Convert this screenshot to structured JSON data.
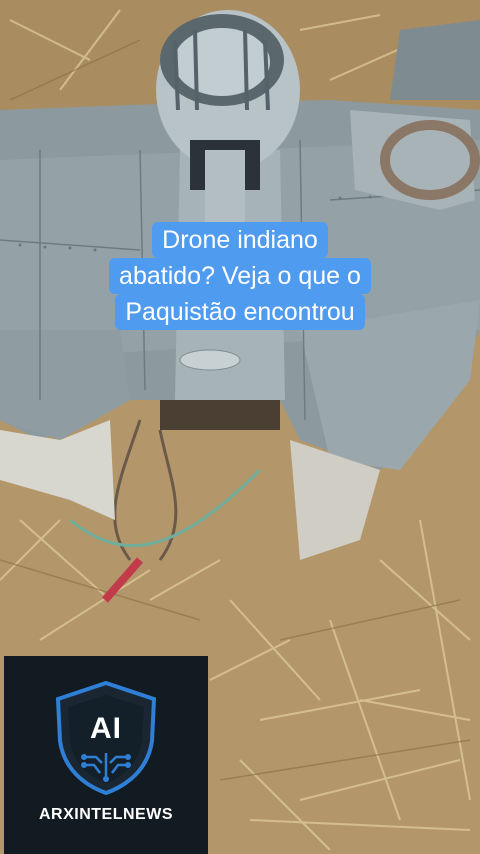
{
  "caption": {
    "line1": "Drone indiano",
    "line2": "abatido? Veja o que o",
    "line3": "Paquistão encontrou"
  },
  "logo": {
    "mark_text": "AI",
    "brand_name": "ARXINTELNEWS",
    "icon": "shield-circuit-icon"
  },
  "colors": {
    "caption_bg": "#4f9bf0",
    "logo_bg": "#121a22",
    "shield_blue": "#2f7fd6"
  }
}
